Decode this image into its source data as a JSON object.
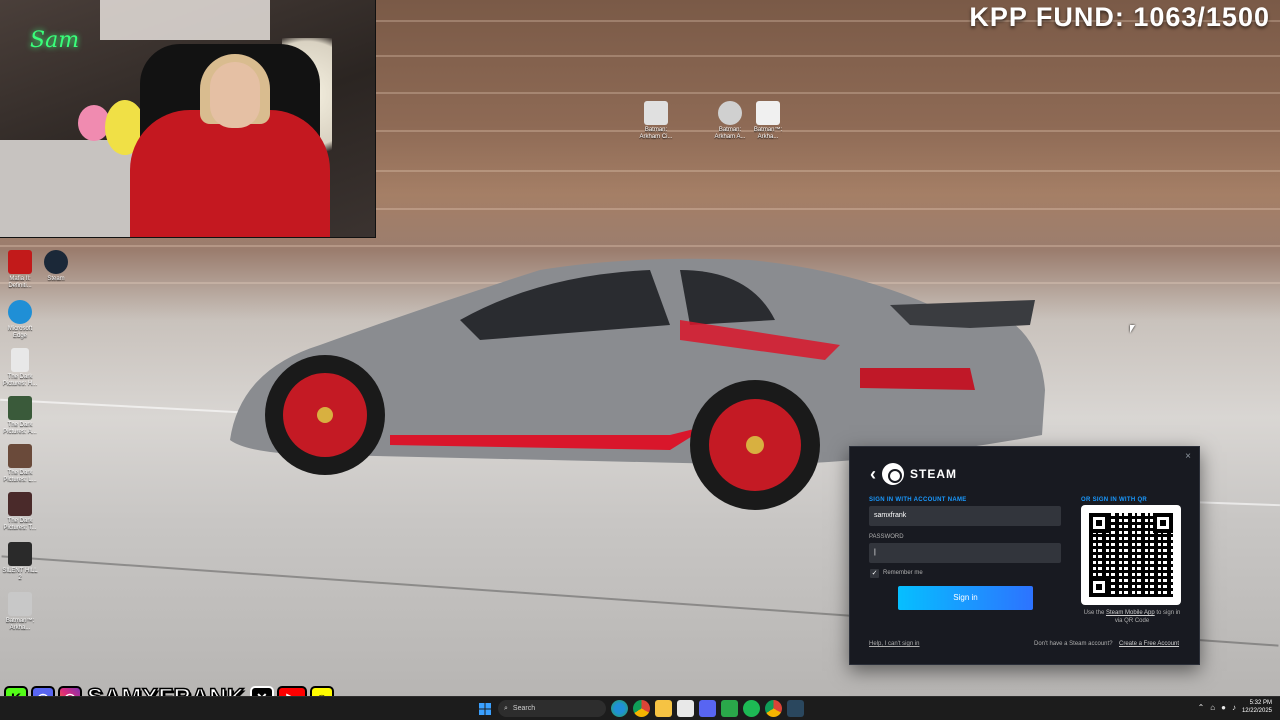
{
  "overlay": {
    "kpp_fund": "KPP FUND: 1063/1500",
    "social_handle": "SAMXFRANK",
    "webcam_neon": "Sam",
    "social_icons": [
      "kick-icon",
      "discord-icon",
      "instagram-icon",
      "x-icon",
      "youtube-icon",
      "snapchat-icon"
    ]
  },
  "desktop": {
    "left_icons": [
      {
        "label": "Mafia II: Definiti...",
        "icon": "mafia-icon",
        "color": "#c21a1a"
      },
      {
        "label": "Steam",
        "icon": "steam-icon",
        "color": "#1b2838"
      },
      {
        "label": "Microsoft Edge",
        "icon": "edge-icon",
        "color": "#1f8fd6"
      },
      {
        "label": "The Dark Pictures: H...",
        "icon": "file-icon",
        "color": "#e8e8e8"
      },
      {
        "label": "The Dark Pictures: A...",
        "icon": "game-icon",
        "color": "#3a5a3a"
      },
      {
        "label": "The Dark Pictures: L...",
        "icon": "game-icon",
        "color": "#6a4a3a"
      },
      {
        "label": "The Dark Pictures: T...",
        "icon": "game-icon",
        "color": "#4a2a2a"
      },
      {
        "label": "SILENT HILL 2",
        "icon": "game-icon",
        "color": "#2a2a2a"
      },
      {
        "label": "Batman™: Arkha...",
        "icon": "batman-icon",
        "color": "#c8c8c8"
      }
    ],
    "top_icons": [
      {
        "label": "Batman: Arkham Ci...",
        "icon": "batman-icon",
        "color": "#e0e0e0"
      },
      {
        "label": "Batman: Arkham A...",
        "icon": "batman-icon",
        "color": "#d0d0d0"
      },
      {
        "label": "Batman™: Arkha...",
        "icon": "batman-icon",
        "color": "#f0f0f0"
      }
    ]
  },
  "steam": {
    "title": "STEAM",
    "account_label": "SIGN IN WITH ACCOUNT NAME",
    "account_value": "samxfrank",
    "password_label": "PASSWORD",
    "password_value": "|",
    "remember_label": "Remember me",
    "remember_checked": true,
    "signin_button": "Sign in",
    "qr_label": "OR SIGN IN WITH QR",
    "qr_note_prefix": "Use the",
    "qr_note_link": "Steam Mobile App",
    "qr_note_suffix": "to sign in via QR Code",
    "help_link": "Help, I can't sign in",
    "no_account": "Don't have a Steam account?",
    "create_link": "Create a Free Account",
    "close": "×"
  },
  "taskbar": {
    "search_placeholder": "Search",
    "time": "5:32 PM",
    "date": "12/22/2025",
    "apps": [
      "edge-icon",
      "chrome-icon",
      "file-explorer-icon",
      "store-icon",
      "discord-icon",
      "xbox-icon",
      "spotify-icon",
      "chrome-icon",
      "steam-icon"
    ]
  },
  "colors": {
    "steam_bg": "#181a21",
    "steam_accent": "#1999ff",
    "signin_gradient_start": "#06bfff",
    "signin_gradient_end": "#2d73ff",
    "car_stripe": "#d9162b"
  }
}
